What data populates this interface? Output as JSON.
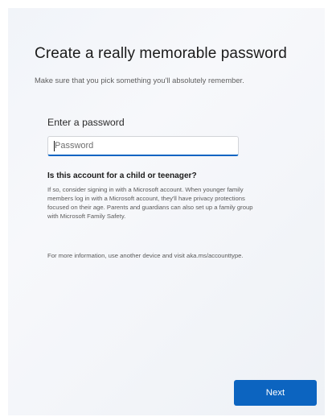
{
  "page": {
    "title": "Create a really memorable password",
    "subtitle": "Make sure that you pick something you'll absolutely remember."
  },
  "password": {
    "label": "Enter a password",
    "placeholder": "Password",
    "value": ""
  },
  "info": {
    "heading": "Is this account for a child or teenager?",
    "body_lines": [
      "If so, consider signing in with a Microsoft account. When younger family",
      "members log in with a Microsoft account, they'll have privacy protections",
      "focused on their age. Parents and guardians can also set up a family group",
      "with Microsoft Family Safety."
    ],
    "more": "For more information, use another device and visit aka.ms/accounttype."
  },
  "actions": {
    "next_label": "Next"
  },
  "colors": {
    "accent": "#0c64c0",
    "background": "#f4f6fa"
  }
}
